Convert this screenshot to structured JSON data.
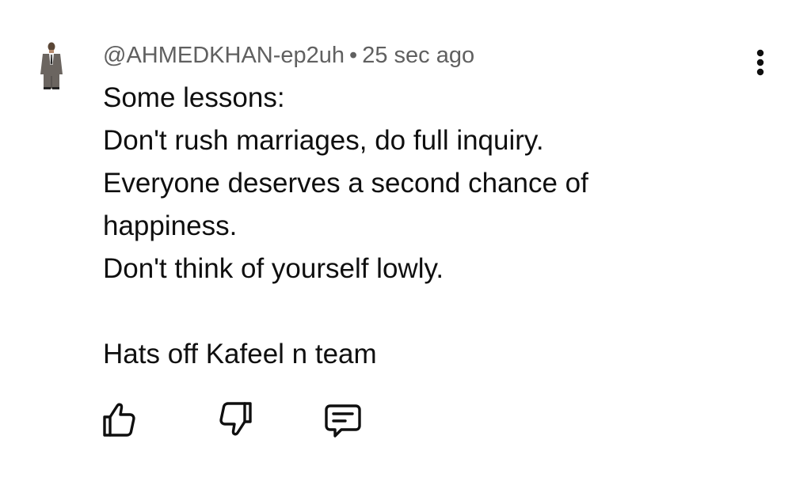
{
  "comment": {
    "author": "@AHMEDKHAN-ep2uh",
    "separator": "•",
    "time": "25 sec ago",
    "lines": [
      "Some lessons:",
      "Don't rush marriages, do full inquiry.",
      "Everyone deserves a second chance of",
      "happiness.",
      "Don't think of yourself lowly.",
      "",
      "Hats off Kafeel n team"
    ]
  },
  "icons": {
    "avatar": "user-avatar",
    "more": "more-vertical-icon",
    "like": "thumbs-up-icon",
    "dislike": "thumbs-down-icon",
    "reply": "reply-comment-icon"
  },
  "colors": {
    "text": "#0f0f0f",
    "meta": "#606060",
    "background": "#ffffff"
  }
}
